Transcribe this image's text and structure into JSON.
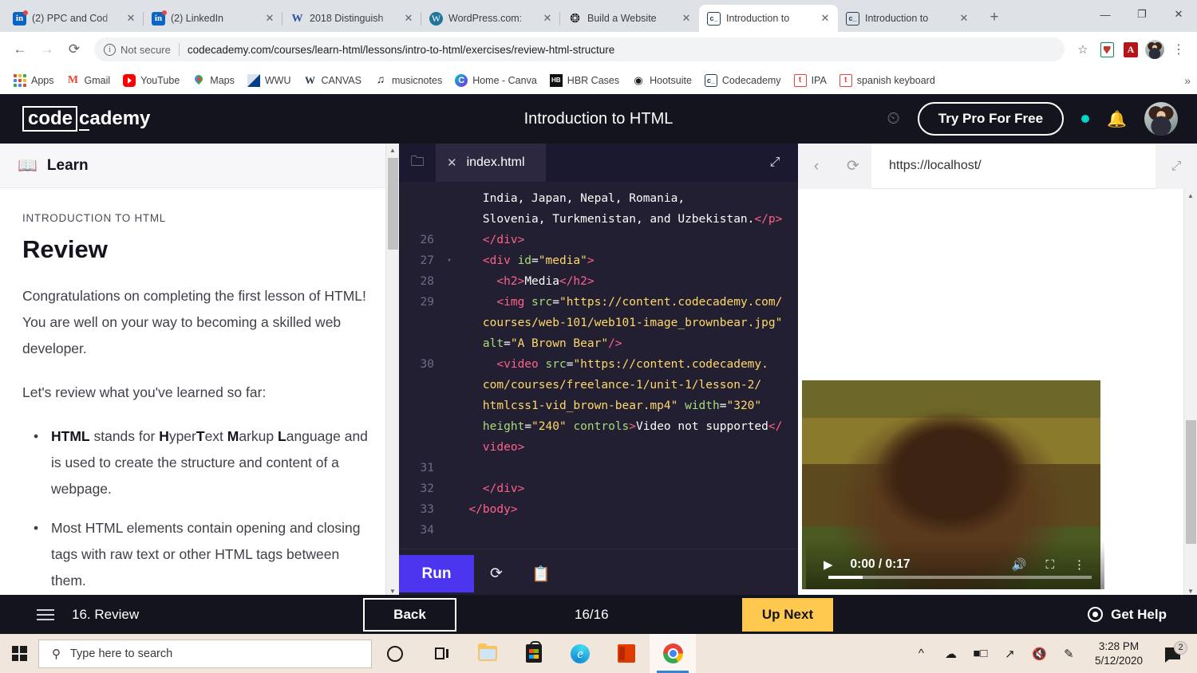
{
  "browser": {
    "tabs": [
      {
        "title": "(2) PPC and Cod",
        "favicon": "linkedin-icon",
        "active": false
      },
      {
        "title": "(2) LinkedIn",
        "favicon": "linkedin-icon",
        "active": false
      },
      {
        "title": "2018 Distinguish",
        "favicon": "word-icon",
        "active": false
      },
      {
        "title": "WordPress.com:",
        "favicon": "wordpress-icon",
        "active": false
      },
      {
        "title": "Build a Website",
        "favicon": "squarespace-icon",
        "active": false
      },
      {
        "title": "Introduction to",
        "favicon": "codecademy-icon",
        "active": true
      },
      {
        "title": "Introduction to",
        "favicon": "codecademy-icon",
        "active": false
      }
    ],
    "newtab_label": "+",
    "window_controls": [
      "—",
      "❐",
      "✕"
    ],
    "nav": {
      "back": "←",
      "forward": "→",
      "reload": "⟳"
    },
    "omnibox": {
      "security_label": "Not secure",
      "url": "codecademy.com/courses/learn-html/lessons/intro-to-html/exercises/review-html-structure",
      "star": "☆"
    },
    "bookmarks": [
      {
        "label": "Apps",
        "icon": "apps-grid-icon"
      },
      {
        "label": "Gmail",
        "icon": "gmail-icon"
      },
      {
        "label": "YouTube",
        "icon": "youtube-icon"
      },
      {
        "label": "Maps",
        "icon": "maps-pin-icon"
      },
      {
        "label": "WWU",
        "icon": "wwu-icon"
      },
      {
        "label": "CANVAS",
        "icon": "canvas-icon"
      },
      {
        "label": "musicnotes",
        "icon": "musicnotes-icon"
      },
      {
        "label": "Home - Canva",
        "icon": "canva-icon"
      },
      {
        "label": "HBR Cases",
        "icon": "hbr-icon"
      },
      {
        "label": "Hootsuite",
        "icon": "hootsuite-owl-icon"
      },
      {
        "label": "Codecademy",
        "icon": "codecademy-icon"
      },
      {
        "label": "IPA",
        "icon": "ipa-icon"
      },
      {
        "label": "spanish keyboard",
        "icon": "ipa-icon"
      }
    ],
    "bookmarks_overflow": "»"
  },
  "codecademy": {
    "logo_mark": "code",
    "logo_rest": "cademy",
    "page_title": "Introduction to HTML",
    "clock_icon": "alarm-clock-icon",
    "try_pro_label": "Try Pro For Free",
    "bell_icon": "bell-icon",
    "learn": {
      "panel_label": "Learn",
      "panel_icon": "book-icon",
      "kicker": "INTRODUCTION TO HTML",
      "title": "Review",
      "paragraph1": "Congratulations on completing the first lesson of HTML! You are well on your way to becoming a skilled web developer.",
      "paragraph2": "Let's review what you've learned so far:",
      "bullets": [
        "HTML stands for HyperText Markup Language and is used to create the structure and content of a webpage.",
        "Most HTML elements contain opening and closing tags with raw text or other HTML tags between them."
      ]
    },
    "editor": {
      "folder_icon": "folder-icon",
      "file_tab": "index.html",
      "close_icon": "close-icon",
      "expand_icon": "expand-icon",
      "run_label": "Run",
      "reset_icon": "reset-icon",
      "save_icon": "save-to-clipboard-icon",
      "lines": [
        {
          "num": "",
          "fold": "",
          "segments": [
            {
              "t": "    India, Japan, Nepal, Romania,",
              "c": "txt"
            }
          ]
        },
        {
          "num": "",
          "fold": "",
          "segments": [
            {
              "t": "    Slovenia, Turkmenistan, and Uzbekistan.",
              "c": "txt"
            },
            {
              "t": "</p>",
              "c": "tag"
            }
          ]
        },
        {
          "num": "26",
          "fold": "",
          "segments": [
            {
              "t": "    </div>",
              "c": "tag"
            }
          ]
        },
        {
          "num": "27",
          "fold": "▾",
          "segments": [
            {
              "t": "    <div ",
              "c": "tag"
            },
            {
              "t": "id",
              "c": "attr"
            },
            {
              "t": "=",
              "c": "punc"
            },
            {
              "t": "\"media\"",
              "c": "str"
            },
            {
              "t": ">",
              "c": "tag"
            }
          ]
        },
        {
          "num": "28",
          "fold": "",
          "segments": [
            {
              "t": "      <h2>",
              "c": "tag"
            },
            {
              "t": "Media",
              "c": "txt"
            },
            {
              "t": "</h2>",
              "c": "tag"
            }
          ]
        },
        {
          "num": "29",
          "fold": "",
          "segments": [
            {
              "t": "      <img ",
              "c": "tag"
            },
            {
              "t": "src",
              "c": "attr"
            },
            {
              "t": "=",
              "c": "punc"
            },
            {
              "t": "\"https://content.codecademy.com/",
              "c": "str"
            }
          ]
        },
        {
          "num": "",
          "fold": "",
          "segments": [
            {
              "t": "    courses/web-101/web101-image_brownbear.jpg\"",
              "c": "str"
            }
          ]
        },
        {
          "num": "",
          "fold": "",
          "segments": [
            {
              "t": "    alt",
              "c": "attr"
            },
            {
              "t": "=",
              "c": "punc"
            },
            {
              "t": "\"A Brown Bear\"",
              "c": "str"
            },
            {
              "t": "/>",
              "c": "tag"
            }
          ]
        },
        {
          "num": "30",
          "fold": "",
          "segments": [
            {
              "t": "      <video ",
              "c": "tag"
            },
            {
              "t": "src",
              "c": "attr"
            },
            {
              "t": "=",
              "c": "punc"
            },
            {
              "t": "\"https://content.codecademy.",
              "c": "str"
            }
          ]
        },
        {
          "num": "",
          "fold": "",
          "segments": [
            {
              "t": "    com/courses/freelance-1/unit-1/lesson-2/",
              "c": "str"
            }
          ]
        },
        {
          "num": "",
          "fold": "",
          "segments": [
            {
              "t": "    htmlcss1-vid_brown-bear.mp4\" ",
              "c": "str"
            },
            {
              "t": "width",
              "c": "attr"
            },
            {
              "t": "=",
              "c": "punc"
            },
            {
              "t": "\"320\"",
              "c": "str"
            }
          ]
        },
        {
          "num": "",
          "fold": "",
          "segments": [
            {
              "t": "    height",
              "c": "attr"
            },
            {
              "t": "=",
              "c": "punc"
            },
            {
              "t": "\"240\" ",
              "c": "str"
            },
            {
              "t": "controls",
              "c": "attr"
            },
            {
              "t": ">",
              "c": "tag"
            },
            {
              "t": "Video not supported",
              "c": "txt"
            },
            {
              "t": "</",
              "c": "tag"
            }
          ]
        },
        {
          "num": "",
          "fold": "",
          "segments": [
            {
              "t": "    video>",
              "c": "tag"
            }
          ]
        },
        {
          "num": "31",
          "fold": "",
          "segments": [
            {
              "t": "",
              "c": "txt"
            }
          ]
        },
        {
          "num": "32",
          "fold": "",
          "segments": [
            {
              "t": "    </div>",
              "c": "tag"
            }
          ]
        },
        {
          "num": "33",
          "fold": "",
          "segments": [
            {
              "t": "  </body>",
              "c": "tag"
            }
          ]
        },
        {
          "num": "34",
          "fold": "",
          "segments": [
            {
              "t": "",
              "c": "txt"
            }
          ]
        }
      ]
    },
    "preview": {
      "back_icon": "chevron-left-icon",
      "reload_icon": "reload-icon",
      "url": "https://localhost/",
      "expand_icon": "expand-icon",
      "image_alt": "A Brown Bear",
      "video": {
        "play_icon": "play-icon",
        "time": "0:00 / 0:17",
        "volume_icon": "volume-icon",
        "fullscreen_icon": "fullscreen-icon",
        "more_icon": "more-options-icon"
      }
    },
    "footer": {
      "menu_icon": "hamburger-menu-icon",
      "lesson_label": "16. Review",
      "back_label": "Back",
      "progress": "16/16",
      "up_next_label": "Up Next",
      "help_label": "Get Help",
      "help_icon": "life-ring-icon"
    }
  },
  "taskbar": {
    "start_icon": "windows-start-icon",
    "search_placeholder": "Type here to search",
    "search_icon": "search-icon",
    "apps": [
      {
        "name": "cortana-icon"
      },
      {
        "name": "task-view-icon"
      },
      {
        "name": "file-explorer-icon"
      },
      {
        "name": "microsoft-store-icon"
      },
      {
        "name": "edge-icon"
      },
      {
        "name": "office-icon"
      },
      {
        "name": "chrome-icon"
      }
    ],
    "tray": [
      "ⱏ",
      "cloud-icon",
      "battery-icon",
      "wifi-icon",
      "volume-muted-icon",
      "pen-icon"
    ],
    "time": "3:28 PM",
    "date": "5/12/2020",
    "notification_count": "2"
  },
  "colors": {
    "cc_dark": "#14141f",
    "editor_bg": "#221f32",
    "run_purple": "#4b35ee",
    "upnext_yellow": "#ffc94f",
    "teal_dot": "#00d4c8",
    "taskbar": "#f0e6dc"
  }
}
